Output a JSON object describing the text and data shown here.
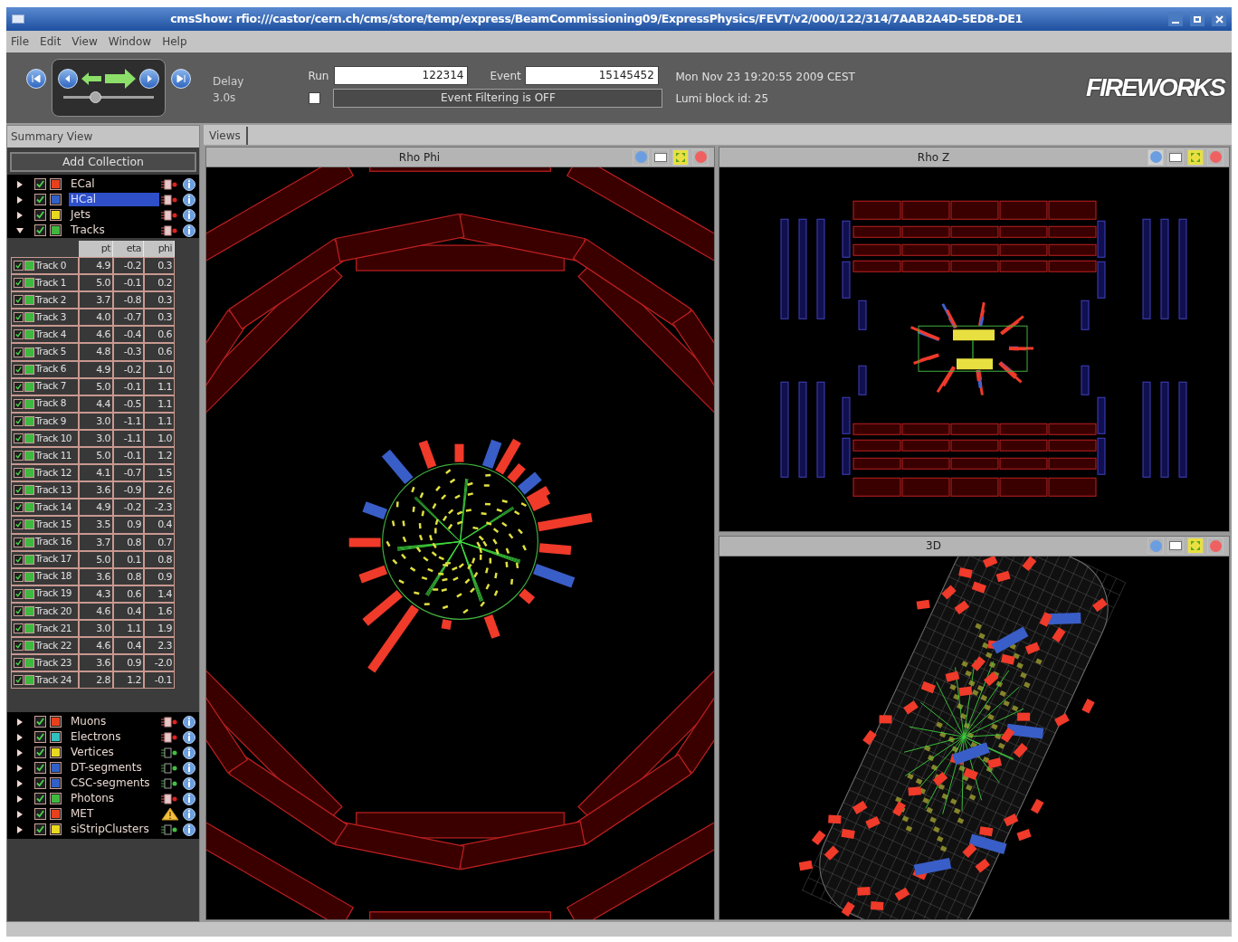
{
  "window": {
    "title": "cmsShow: rfio:///castor/cern.ch/cms/store/temp/express/BeamCommissioning09/ExpressPhysics/FEVT/v2/000/122/314/7AAB2A4D-5ED8-DE1"
  },
  "menu": [
    "File",
    "Edit",
    "View",
    "Window",
    "Help"
  ],
  "toolbar": {
    "delay_label": "Delay",
    "delay_value": "3.0s",
    "playback": {
      "level": 0.35
    },
    "run_label": "Run",
    "run": "122314",
    "event_label": "Event",
    "event": "15145452",
    "filter": {
      "checked": false,
      "label": "Event Filtering is OFF"
    },
    "datetime": "Mon Nov 23 19:20:55 2009 CEST",
    "lumi": "Lumi block id: 25",
    "logo": "FIREWORKS"
  },
  "summary": {
    "title": "Summary View",
    "add_button": "Add Collection",
    "collections": [
      {
        "name": "ECal",
        "checked": true,
        "color": "#e8401c",
        "expanded": false,
        "selected": false,
        "kind": "filled"
      },
      {
        "name": "HCal",
        "checked": true,
        "color": "#3060c8",
        "expanded": false,
        "selected": true,
        "kind": "filled"
      },
      {
        "name": "Jets",
        "checked": true,
        "color": "#e8d820",
        "expanded": false,
        "selected": false,
        "kind": "filled"
      },
      {
        "name": "Tracks",
        "checked": true,
        "color": "#40b840",
        "expanded": true,
        "selected": false,
        "kind": "filled",
        "table": {
          "columns": [
            "pt",
            "eta",
            "phi"
          ],
          "rows": [
            {
              "label": "Track 0",
              "checked": true,
              "values": [
                "4.9",
                "-0.2",
                "0.3"
              ]
            },
            {
              "label": "Track 1",
              "checked": true,
              "values": [
                "5.0",
                "-0.1",
                "0.2"
              ]
            },
            {
              "label": "Track 2",
              "checked": true,
              "values": [
                "3.7",
                "-0.8",
                "0.3"
              ]
            },
            {
              "label": "Track 3",
              "checked": true,
              "values": [
                "4.0",
                "-0.7",
                "0.3"
              ]
            },
            {
              "label": "Track 4",
              "checked": true,
              "values": [
                "4.6",
                "-0.4",
                "0.6"
              ]
            },
            {
              "label": "Track 5",
              "checked": true,
              "values": [
                "4.8",
                "-0.3",
                "0.6"
              ]
            },
            {
              "label": "Track 6",
              "checked": true,
              "values": [
                "4.9",
                "-0.2",
                "1.0"
              ]
            },
            {
              "label": "Track 7",
              "checked": true,
              "values": [
                "5.0",
                "-0.1",
                "1.1"
              ]
            },
            {
              "label": "Track 8",
              "checked": true,
              "values": [
                "4.4",
                "-0.5",
                "1.1"
              ]
            },
            {
              "label": "Track 9",
              "checked": true,
              "values": [
                "3.0",
                "-1.1",
                "1.1"
              ]
            },
            {
              "label": "Track 10",
              "checked": true,
              "values": [
                "3.0",
                "-1.1",
                "1.0"
              ]
            },
            {
              "label": "Track 11",
              "checked": true,
              "values": [
                "5.0",
                "-0.1",
                "1.2"
              ]
            },
            {
              "label": "Track 12",
              "checked": true,
              "values": [
                "4.1",
                "-0.7",
                "1.5"
              ]
            },
            {
              "label": "Track 13",
              "checked": true,
              "values": [
                "3.6",
                "-0.9",
                "2.6"
              ]
            },
            {
              "label": "Track 14",
              "checked": true,
              "values": [
                "4.9",
                "-0.2",
                "-2.3"
              ]
            },
            {
              "label": "Track 15",
              "checked": true,
              "values": [
                "3.5",
                "0.9",
                "0.4"
              ]
            },
            {
              "label": "Track 16",
              "checked": true,
              "values": [
                "3.7",
                "0.8",
                "0.7"
              ]
            },
            {
              "label": "Track 17",
              "checked": true,
              "values": [
                "5.0",
                "0.1",
                "0.8"
              ]
            },
            {
              "label": "Track 18",
              "checked": true,
              "values": [
                "3.6",
                "0.8",
                "0.9"
              ]
            },
            {
              "label": "Track 19",
              "checked": true,
              "values": [
                "4.3",
                "0.6",
                "1.4"
              ]
            },
            {
              "label": "Track 20",
              "checked": true,
              "values": [
                "4.6",
                "0.4",
                "1.6"
              ]
            },
            {
              "label": "Track 21",
              "checked": true,
              "values": [
                "3.0",
                "1.1",
                "1.9"
              ]
            },
            {
              "label": "Track 22",
              "checked": true,
              "values": [
                "4.6",
                "0.4",
                "2.3"
              ]
            },
            {
              "label": "Track 23",
              "checked": true,
              "values": [
                "3.6",
                "0.9",
                "-2.0"
              ]
            },
            {
              "label": "Track 24",
              "checked": true,
              "values": [
                "2.8",
                "1.2",
                "-0.1"
              ]
            }
          ]
        }
      }
    ],
    "more_collections": [
      {
        "name": "Muons",
        "checked": true,
        "color": "#e8401c",
        "expanded": false,
        "selected": false,
        "kind": "filled"
      },
      {
        "name": "Electrons",
        "checked": true,
        "color": "#30c0c0",
        "expanded": false,
        "selected": false,
        "kind": "filled"
      },
      {
        "name": "Vertices",
        "checked": true,
        "color": "#e8d820",
        "expanded": false,
        "selected": false,
        "kind": "outline"
      },
      {
        "name": "DT-segments",
        "checked": true,
        "color": "#3060c8",
        "expanded": false,
        "selected": false,
        "kind": "outline"
      },
      {
        "name": "CSC-segments",
        "checked": true,
        "color": "#3060c8",
        "expanded": false,
        "selected": false,
        "kind": "outline"
      },
      {
        "name": "Photons",
        "checked": true,
        "color": "#40b840",
        "expanded": false,
        "selected": false,
        "kind": "filled"
      },
      {
        "name": "MET",
        "checked": true,
        "color": "#e8401c",
        "expanded": false,
        "selected": false,
        "kind": "warning"
      },
      {
        "name": "siStripClusters",
        "checked": true,
        "color": "#e8d820",
        "expanded": false,
        "selected": false,
        "kind": "outline"
      }
    ]
  },
  "views": {
    "tab": "Views",
    "panels": [
      {
        "title": "Rho Phi",
        "kind": "rhophi"
      },
      {
        "title": "Rho Z",
        "kind": "rhoz"
      },
      {
        "title": "3D",
        "kind": "threed"
      }
    ]
  }
}
